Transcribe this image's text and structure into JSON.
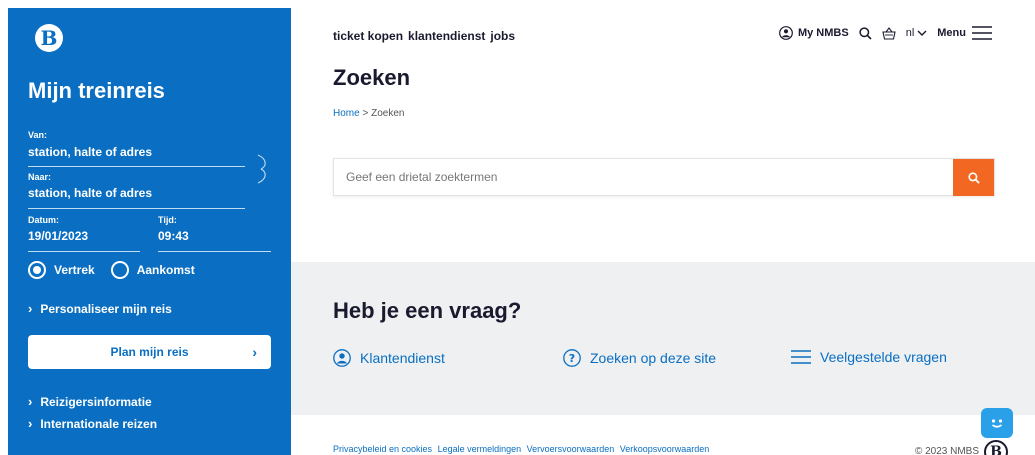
{
  "sidebar": {
    "logo": "B",
    "title": "Mijn treinreis",
    "from": {
      "label": "Van:",
      "value": "station, halte of adres"
    },
    "to": {
      "label": "Naar:",
      "value": "station, halte of adres"
    },
    "date": {
      "label": "Datum:",
      "value": "19/01/2023"
    },
    "time": {
      "label": "Tijd:",
      "value": "09:43"
    },
    "departure_label": "Vertrek",
    "arrival_label": "Aankomst",
    "personalise_label": "Personaliseer mijn reis",
    "plan_button": "Plan mijn reis",
    "traveller_info": "Reizigersinformatie",
    "international": "Internationale reizen"
  },
  "header": {
    "nav": [
      "ticket kopen",
      "klantendienst",
      "jobs"
    ],
    "my_account": "My NMBS",
    "language": "nl",
    "menu": "Menu"
  },
  "main": {
    "title": "Zoeken",
    "breadcrumb_home": "Home",
    "breadcrumb_sep": " > ",
    "breadcrumb_current": "Zoeken",
    "search_placeholder": "Geef een drietal zoektermen"
  },
  "faq": {
    "title": "Heb je een vraag?",
    "links": [
      "Klantendienst",
      "Zoeken op deze site",
      "Veelgestelde vragen"
    ]
  },
  "footer": {
    "links": [
      "Privacybeleid en cookies",
      "Legale vermeldingen",
      "Vervoersvoorwaarden",
      "Verkoopsvoorwaarden"
    ],
    "copyright": "© 2023 NMBS",
    "logo": "B"
  },
  "colors": {
    "brand_blue": "#0a6fc2",
    "accent_orange": "#f26722",
    "faq_bg": "#eef0f2"
  },
  "icons": [
    "user-icon",
    "search-icon",
    "basket-icon",
    "chevron-down-icon",
    "menu-icon",
    "swap-icon",
    "question-icon",
    "list-icon",
    "chat-bot-icon"
  ]
}
